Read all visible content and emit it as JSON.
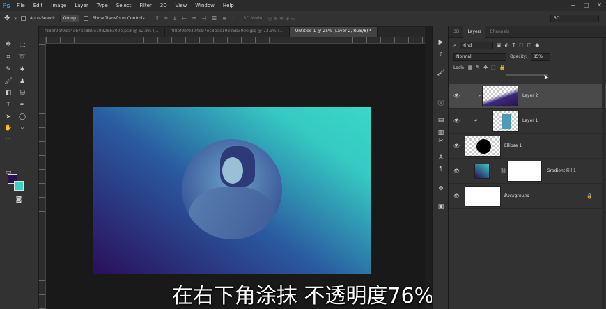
{
  "app": {
    "logo": "Ps"
  },
  "menu": [
    "File",
    "Edit",
    "Image",
    "Layer",
    "Type",
    "Select",
    "Filter",
    "3D",
    "View",
    "Window",
    "Help"
  ],
  "options": {
    "auto_select_label": "Auto-Select:",
    "auto_select_value": "Group",
    "show_transform_label": "Show Transform Controls",
    "mode_3d_label": "3D Mode:",
    "workspace_value": "3D"
  },
  "tabs": [
    {
      "label": "f88bf9bf9304eb7ec8b0e19325b300e.psd @ 62.8% (..."
    },
    {
      "label": "f88bf9bf9304eb7ec8b0e19325b300e.jpg @ 73.3% (..."
    },
    {
      "label": "Untitled-1 @ 25% (Layer 2, RGB/8) *"
    }
  ],
  "panel": {
    "tabs": [
      "3D",
      "Layers",
      "Channels"
    ],
    "kind_label": "Kind",
    "blend_mode": "Normal",
    "opacity_label": "Opacity:",
    "opacity_value": "85%",
    "lock_label": "Lock:",
    "layers": [
      {
        "name": "Layer 2",
        "selected": true
      },
      {
        "name": "Layer 1",
        "selected": false
      },
      {
        "name": "Ellipse 1",
        "selected": false
      },
      {
        "name": "Gradient Fill 1",
        "selected": false
      },
      {
        "name": "Background",
        "selected": false
      }
    ]
  },
  "colors": {
    "foreground": "#2a1250",
    "background": "#3ad2c3",
    "accent": "#31a8ff"
  },
  "subtitle": "在右下角涂抹  不透明度76%"
}
